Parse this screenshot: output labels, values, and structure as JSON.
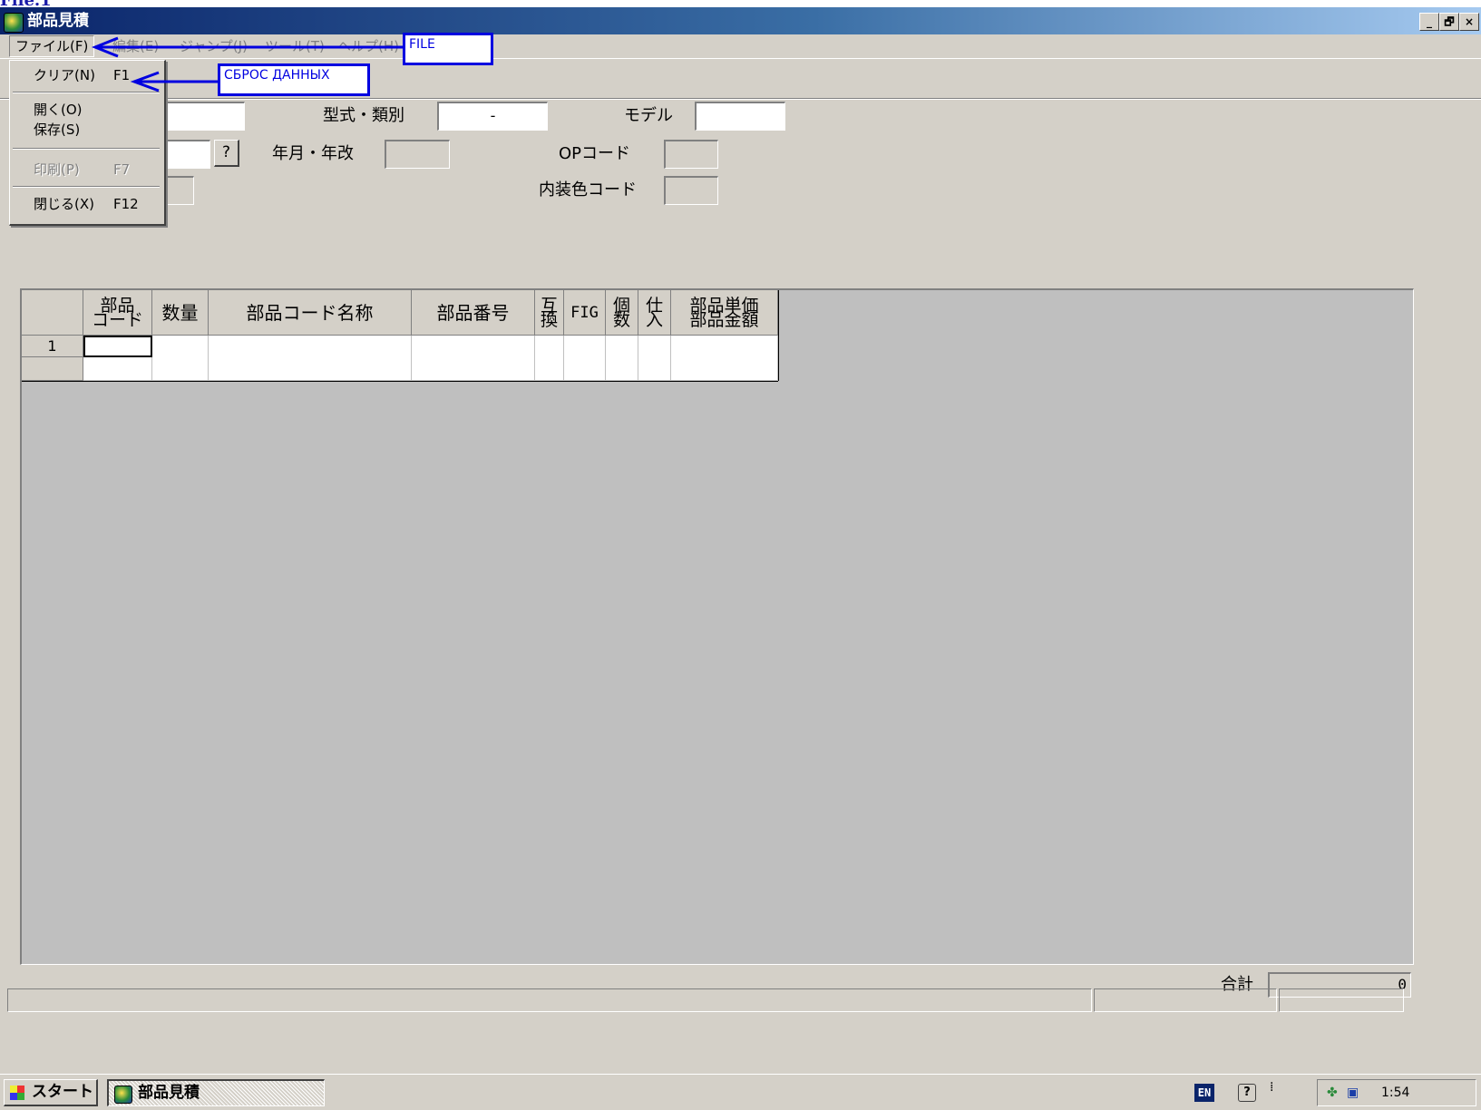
{
  "page_caption": "File.1",
  "window": {
    "title": "部品見積",
    "minimize": "_",
    "restore": "🗗",
    "close": "×"
  },
  "menubar": {
    "items": [
      {
        "label": "ファイル(F)"
      },
      {
        "label": "編集(E)"
      },
      {
        "label": "ジャンプ(J)"
      },
      {
        "label": "ツール(T)"
      },
      {
        "label": "ヘルプ(H)"
      }
    ]
  },
  "file_menu": {
    "clear": {
      "label": "クリア(N)",
      "key": "F1"
    },
    "open": {
      "label": "開く(O)"
    },
    "save": {
      "label": "保存(S)"
    },
    "print": {
      "label": "印刷(P)",
      "key": "F7"
    },
    "close": {
      "label": "閉じる(X)",
      "key": "F12"
    }
  },
  "annotations": {
    "file": "FILE",
    "reset": "СБРОС ДАННЫХ"
  },
  "form": {
    "type_label": "型式・類別",
    "type_value": "-",
    "model_label": "モデル",
    "model_value": "",
    "search_button": "?",
    "year_label": "年月・年改",
    "op_label": "OPコード",
    "interior_label": "内装色コード"
  },
  "table": {
    "headers": {
      "part_code": [
        "部品",
        "コード"
      ],
      "qty": "数量",
      "part_name": "部品コード名称",
      "part_number": "部品番号",
      "compat": [
        "互",
        "換"
      ],
      "fig": "FIG",
      "count": [
        "個",
        "数"
      ],
      "stock": [
        "仕",
        "入"
      ],
      "price": [
        "部品単価",
        "部品金額"
      ]
    },
    "row_number": "1"
  },
  "total": {
    "label": "合計",
    "value": "0"
  },
  "taskbar": {
    "start": "スタート",
    "task": "部品見積",
    "lang": "EN",
    "help": "?",
    "clock": "1:54"
  },
  "colors": {
    "annotation_blue": "#0000e0",
    "title_gradient_start": "#0a246a",
    "window_face": "#d4d0c8",
    "grid_background": "#bfbfbf"
  }
}
